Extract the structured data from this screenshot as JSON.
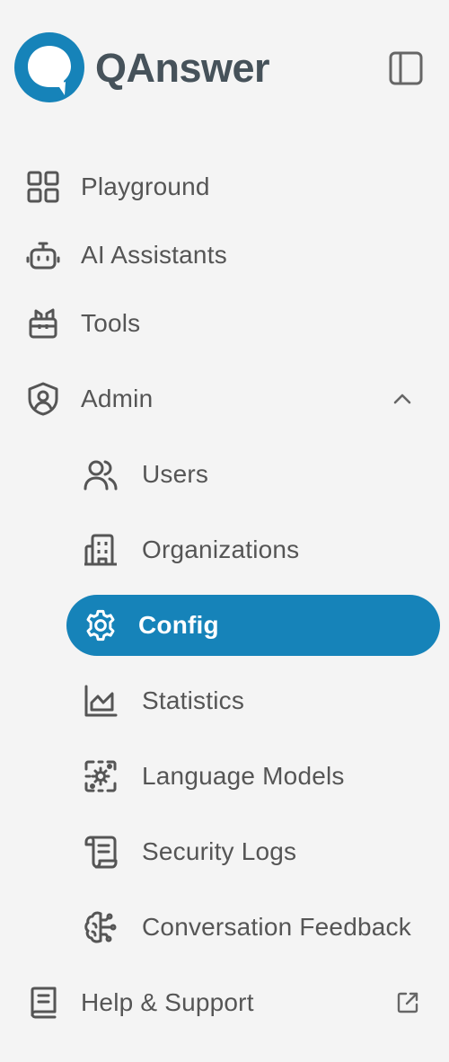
{
  "brand": {
    "name": "QAnswer",
    "accent_color": "#1683b9",
    "logo_icon": "qanswer-logo-icon"
  },
  "header": {
    "panel_toggle_icon": "sidebar-panel-icon"
  },
  "nav": {
    "items": [
      {
        "label": "Playground",
        "icon": "grid-icon"
      },
      {
        "label": "AI Assistants",
        "icon": "robot-icon"
      },
      {
        "label": "Tools",
        "icon": "toolbox-icon"
      },
      {
        "label": "Admin",
        "icon": "shield-user-icon",
        "expanded": true
      }
    ],
    "admin_sub": [
      {
        "label": "Users",
        "icon": "users-icon"
      },
      {
        "label": "Organizations",
        "icon": "building-icon"
      },
      {
        "label": "Config",
        "icon": "gear-icon",
        "active": true
      },
      {
        "label": "Statistics",
        "icon": "chart-icon"
      },
      {
        "label": "Language Models",
        "icon": "cpu-icon"
      },
      {
        "label": "Security Logs",
        "icon": "scroll-icon"
      },
      {
        "label": "Conversation Feedback",
        "icon": "brain-icon"
      }
    ],
    "help": {
      "label": "Help & Support",
      "icon": "book-icon",
      "external_icon": "external-link-icon"
    }
  }
}
